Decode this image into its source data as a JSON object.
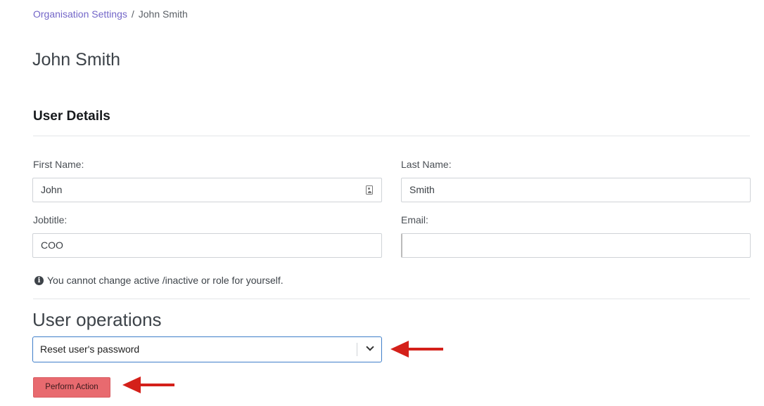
{
  "breadcrumb": {
    "parent": "Organisation Settings",
    "separator": "/",
    "current": "John Smith"
  },
  "page_title": "John Smith",
  "user_details": {
    "section_title": "User Details",
    "first_name": {
      "label": "First Name:",
      "value": "John"
    },
    "last_name": {
      "label": "Last Name:",
      "value": "Smith"
    },
    "jobtitle": {
      "label": "Jobtitle:",
      "value": "COO"
    },
    "email": {
      "label": "Email:",
      "value": ""
    }
  },
  "info_note": "You cannot change active /inactive or role for yourself.",
  "user_operations": {
    "title": "User operations",
    "selected_operation": "Reset user's password",
    "action_button": "Perform Action"
  },
  "colors": {
    "link": "#7366c8",
    "focus_border": "#3f7ec9",
    "danger_button": "#e86a6f",
    "annotation_arrow": "#d4201a"
  },
  "icons": {
    "info": "info-circle-icon",
    "contact_card": "contact-card-icon",
    "dropdown": "chevron-down-icon",
    "annotation": "red-arrow-icon"
  }
}
